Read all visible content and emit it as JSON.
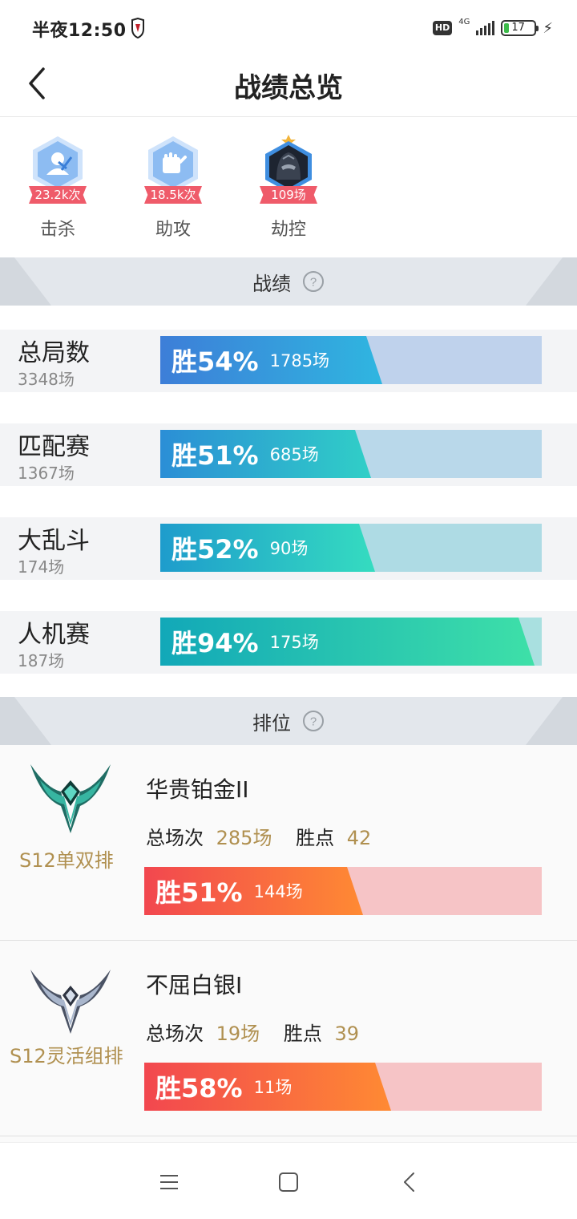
{
  "status_bar": {
    "time": "半夜12:50",
    "hd": "HD",
    "network": "4G",
    "battery": "17"
  },
  "header": {
    "title": "战绩总览"
  },
  "highlights": [
    {
      "count": "23.2k次",
      "label": "击杀",
      "icon": "kill-icon"
    },
    {
      "count": "18.5k次",
      "label": "助攻",
      "icon": "assist-icon"
    },
    {
      "count": "109场",
      "label": "劫控",
      "icon": "champion-avatar"
    }
  ],
  "record_section": {
    "title": "战绩",
    "help_icon": "help-icon",
    "rows": [
      {
        "name": "总局数",
        "games": "3348场",
        "win_label": "胜54%",
        "win_games": "1785场",
        "win_rate": 0.54,
        "colors": [
          "#3d7ed8",
          "#2fb6e0"
        ],
        "track": "#bfd2ec"
      },
      {
        "name": "匹配赛",
        "games": "1367场",
        "win_label": "胜51%",
        "win_games": "685场",
        "win_rate": 0.51,
        "colors": [
          "#2b8ed6",
          "#30cfc7"
        ],
        "track": "#b9d8ea"
      },
      {
        "name": "大乱斗",
        "games": "174场",
        "win_label": "胜52%",
        "win_games": "90场",
        "win_rate": 0.52,
        "colors": [
          "#1e9ccc",
          "#35dcc0"
        ],
        "track": "#aedbe4"
      },
      {
        "name": "人机赛",
        "games": "187场",
        "win_label": "胜94%",
        "win_games": "175场",
        "win_rate": 0.94,
        "colors": [
          "#12a8b8",
          "#3ee0a8"
        ],
        "track": "#a9e0e0"
      }
    ]
  },
  "ranked_section": {
    "title": "排位",
    "help_icon": "help-icon",
    "cards": [
      {
        "queue": "S12单双排",
        "tier": "华贵铂金II",
        "total_label": "总场次",
        "total": "285场",
        "points_label": "胜点",
        "points": "42",
        "win_label": "胜51%",
        "win_games": "144场",
        "win_rate": 0.51,
        "emblem": "platinum-emblem"
      },
      {
        "queue": "S12灵活组排",
        "tier": "不屈白银I",
        "total_label": "总场次",
        "total": "19场",
        "points_label": "胜点",
        "points": "39",
        "win_label": "胜58%",
        "win_games": "11场",
        "win_rate": 0.58,
        "emblem": "silver-emblem"
      }
    ]
  },
  "nav": {
    "menu_icon": "menu-icon",
    "home_icon": "home-icon",
    "back_icon": "back-icon"
  }
}
